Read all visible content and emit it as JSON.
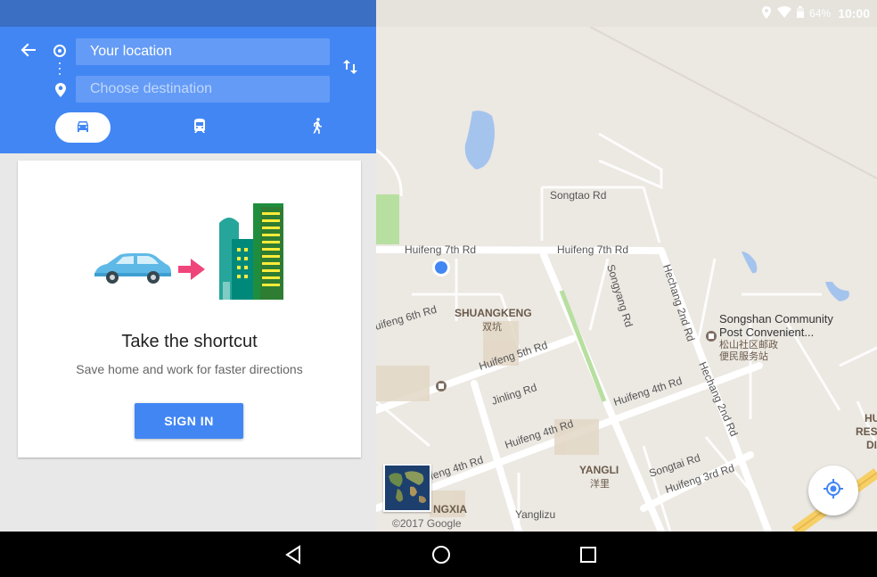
{
  "status_bar": {
    "battery_percent": "64%",
    "time": "10:00"
  },
  "directions": {
    "origin_value": "Your location",
    "destination_placeholder": "Choose destination",
    "modes": [
      "car-icon",
      "train-icon",
      "walk-icon"
    ],
    "selected_mode": "car"
  },
  "card": {
    "title": "Take the shortcut",
    "subtitle": "Save home and work for faster directions",
    "button_label": "SIGN IN"
  },
  "map": {
    "labels": {
      "songtao": "Songtao Rd",
      "huifeng7_a": "Huifeng 7th Rd",
      "huifeng7_b": "Huifeng 7th Rd",
      "songyang": "Songyang Rd",
      "hechang2_a": "Hechang 2nd Rd",
      "hechang2_b": "Hechang 2nd Rd",
      "huifeng6": "uifeng 6th Rd",
      "shuangkeng": "SHUANGKENG",
      "shuangkeng_cn": "双坑",
      "huifeng5": "Huifeng 5th Rd",
      "jinling": "Jinling Rd",
      "huifeng4_a": "Huifeng 4th Rd",
      "huifeng4_b": "Huifeng 4th Rd",
      "huifeng4_c": "feng 4th Rd",
      "yangli": "YANGLI",
      "yangli_cn": "洋里",
      "songtai": "Songtai Rd",
      "huifeng3": "Huifeng 3rd Rd",
      "ngxia": "NGXIA",
      "yanglizu": "Yanglizu",
      "poi_name_1": "Songshan Community",
      "poi_name_2": "Post Convenient...",
      "poi_cn_1": "松山社区邮政",
      "poi_cn_2": "便民服务站",
      "edge_1": "HU",
      "edge_2": "RESI",
      "edge_3": "DI"
    },
    "copyright": "©2017 Google"
  },
  "colors": {
    "header_blue": "#4286f4",
    "status_blue": "#3a6fc4",
    "map_bg": "#ece8e2",
    "water": "#a4c4ee",
    "park": "#b7dfa0"
  }
}
